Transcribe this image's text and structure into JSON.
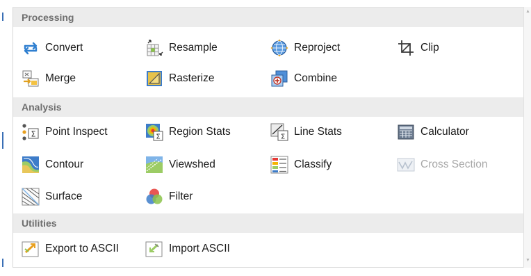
{
  "sections": {
    "processing": "Processing",
    "analysis": "Analysis",
    "utilities": "Utilities"
  },
  "tools": {
    "convert": "Convert",
    "resample": "Resample",
    "reproject": "Reproject",
    "clip": "Clip",
    "merge": "Merge",
    "rasterize": "Rasterize",
    "combine": "Combine",
    "point_inspect": "Point Inspect",
    "region_stats": "Region Stats",
    "line_stats": "Line Stats",
    "calculator": "Calculator",
    "contour": "Contour",
    "viewshed": "Viewshed",
    "classify": "Classify",
    "cross_section": "Cross Section",
    "surface": "Surface",
    "filter": "Filter",
    "export_ascii": "Export to ASCII",
    "import_ascii": "Import ASCII"
  },
  "states": {
    "cross_section_disabled": true
  },
  "colors": {
    "header_bg": "#ececec",
    "header_text": "#6e6e6e",
    "disabled_text": "#a8a8a8",
    "accent_blue": "#2f7fd0"
  },
  "icons": {
    "scroll_up": "▲",
    "scroll_down": "▼"
  }
}
